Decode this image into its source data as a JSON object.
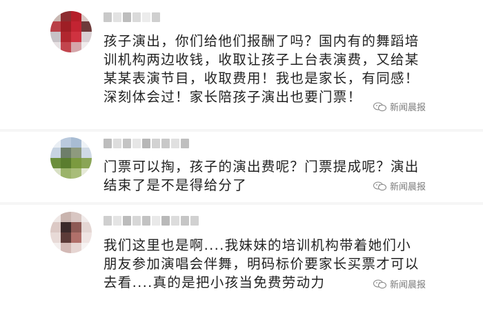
{
  "comments": [
    {
      "id": "c1",
      "lines": [
        "孩子演出，你们给他们报酬了吗？国内有的舞蹈培",
        "训机构两边收钱，收取让孩子上台表演费，又给某",
        "某某表演节目，收取费用！我也是家长，有同感！",
        "深刻体会过！家长陪孩子演出也要门票！"
      ],
      "watermark": "新闻晨报",
      "avatar_colors": [
        "#c9b7b2",
        "#8d2d31",
        "#b51f2a",
        "#d8c8c5",
        "#b94047",
        "#9e1e25",
        "#c32432",
        "#6e3a3a",
        "#c7c2c6",
        "#b0262e",
        "#cf3240",
        "#d9cfd2",
        "#e7e1e3",
        "#c2454d",
        "#d5a6aa",
        "#f0ecec"
      ]
    },
    {
      "id": "c2",
      "lines": [
        "门票可以掏，孩子的演出费呢？门票提成呢？演出",
        "结束了是不是得给分了"
      ],
      "watermark": "新闻晨报",
      "avatar_colors": [
        "#e9eef4",
        "#b9c9dd",
        "#a8bcd3",
        "#eef2f6",
        "#c7d3e2",
        "#6e7e6a",
        "#8e9a7e",
        "#cfd9e5",
        "#6b8e3c",
        "#5a7d2e",
        "#7b9a3f",
        "#8aa556",
        "#d8e0c4",
        "#9bb36a",
        "#a9bd7a",
        "#e6ead8"
      ]
    },
    {
      "id": "c3",
      "lines": [
        "我们这里也是啊....我妹妹的培训机构带着她们小",
        "朋友参加演唱会伴舞，明码标价要家长买票才可以",
        "去看....真的是把小孩当免费劳动力"
      ],
      "watermark": "新闻晨报",
      "avatar_colors": [
        "#efe7e5",
        "#c9b4ae",
        "#d8c6c2",
        "#f1ebea",
        "#dcc9c5",
        "#3b2a2a",
        "#8d5a55",
        "#e4d6d3",
        "#e8dad7",
        "#5c3b38",
        "#b0706a",
        "#efe4e2",
        "#f4efee",
        "#d3b9b5",
        "#e6d5d2",
        "#f7f3f2"
      ]
    }
  ],
  "colors": {
    "text": "#222222",
    "watermark": "#7b7b7b",
    "divider": "#f6f6f6"
  }
}
